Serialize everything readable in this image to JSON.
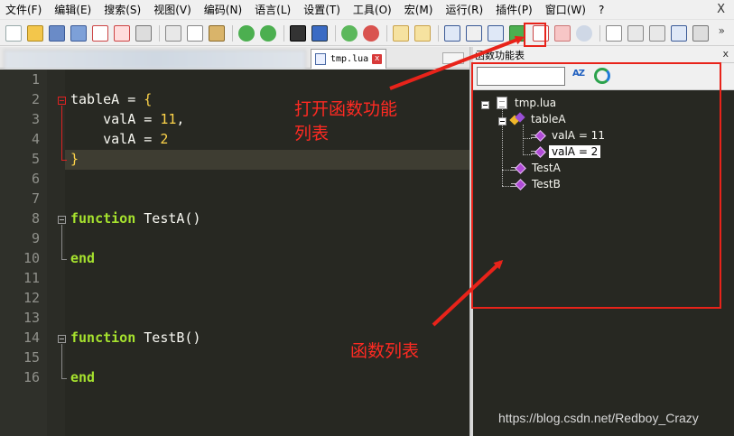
{
  "menu": {
    "items": [
      "文件(F)",
      "编辑(E)",
      "搜索(S)",
      "视图(V)",
      "编码(N)",
      "语言(L)",
      "设置(T)",
      "工具(O)",
      "宏(M)",
      "运行(R)",
      "插件(P)",
      "窗口(W)",
      "?"
    ],
    "close_label": "X"
  },
  "toolbar": {
    "icons": [
      "new-file-icon",
      "open-file-icon",
      "save-icon",
      "save-all-icon",
      "close-icon",
      "close-all-icon",
      "print-icon",
      "cut-icon",
      "copy-icon",
      "paste-icon",
      "undo-icon",
      "redo-icon",
      "find-icon",
      "replace-icon",
      "zoom-in-icon",
      "zoom-out-icon",
      "sync-vertical-icon",
      "sync-horizontal-icon",
      "word-wrap-icon",
      "show-all-chars-icon",
      "indent-guide-icon",
      "document-map-icon",
      "function-list-icon",
      "folder-as-workspace-icon",
      "monitoring-icon",
      "record-macro-icon",
      "stop-record-icon",
      "play-macro-icon",
      "run-macro-multiple-icon",
      "save-macro-icon"
    ],
    "more_label": "»"
  },
  "tabs": {
    "active": {
      "label": "tmp.lua",
      "close_label": "x"
    }
  },
  "editor": {
    "line_numbers": [
      "1",
      "2",
      "3",
      "4",
      "5",
      "6",
      "7",
      "8",
      "9",
      "10",
      "11",
      "12",
      "13",
      "14",
      "15",
      "16"
    ],
    "code": {
      "l2_a": "tableA = ",
      "l2_b": "{",
      "l3_a": "    valA = ",
      "l3_b": "11",
      "l3_c": ",",
      "l4_a": "    valA = ",
      "l4_b": "2",
      "l5": "}",
      "l8_kw": "function",
      "l8_rest": " TestA()",
      "l10": "end",
      "l14_kw": "function",
      "l14_rest": " TestB()",
      "l16": "end"
    }
  },
  "function_list": {
    "title": "函数功能表",
    "close_label": "x",
    "sort_label": "AZ",
    "tree": {
      "root": "tmp.lua",
      "class": "tableA",
      "members": [
        "valA = 11",
        "valA = 2"
      ],
      "functions": [
        "TestA",
        "TestB"
      ]
    }
  },
  "annotations": {
    "open_function_list": "打开函数功能\n列表",
    "function_list": "函数列表"
  },
  "watermark": "https://blog.csdn.net/Redboy_Crazy",
  "colors": {
    "editor_bg": "#272822",
    "keyword": "#a6e22e",
    "number": "#ffd54a",
    "annotation": "#e8231a"
  }
}
